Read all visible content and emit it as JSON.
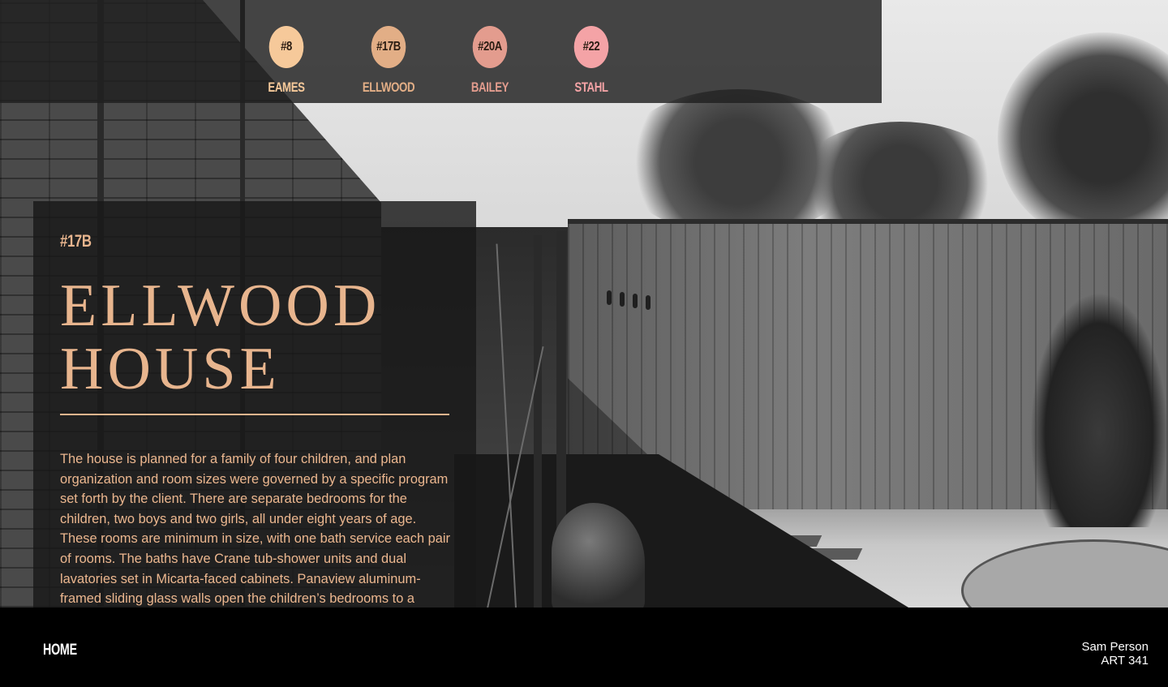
{
  "nav": {
    "items": [
      {
        "code": "#8",
        "label": "EAMES",
        "color": "#f6c99a",
        "label_color": "#f6c99a"
      },
      {
        "code": "#17B",
        "label": "ELLWOOD",
        "color": "#e2ae86",
        "label_color": "#e2ae86"
      },
      {
        "code": "#20A",
        "label": "BAILEY",
        "color": "#e39c8e",
        "label_color": "#e39c8e"
      },
      {
        "code": "#22",
        "label": "STAHL",
        "color": "#f4a3a6",
        "label_color": "#f4a3a6"
      }
    ]
  },
  "panel": {
    "code": "#17B",
    "title_line1": "ELLWOOD",
    "title_line2": "HOUSE",
    "accent": "#e8b58e",
    "body": "The house is planned for a family of four children, and plan organization and room sizes were governed by a specific program set forth by the client. There are separate bedrooms for the children, two boys and two girls, all under eight years of age. These rooms are minimum in size, with one bath service each pair of rooms. The baths have Crane tub-shower units and dual lavatories set in Micarta-faced cabinets. Panaview aluminum-framed sliding glass walls open the children’s bedrooms to a garden court walled"
  },
  "footer": {
    "home_label": "HOME",
    "author": "Sam Person",
    "course": "ART 341"
  }
}
